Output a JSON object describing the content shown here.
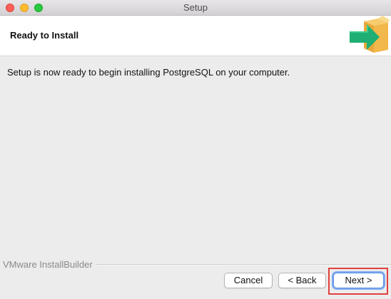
{
  "window": {
    "title": "Setup"
  },
  "header": {
    "title": "Ready to Install",
    "icon": "installer-box-arrow-icon"
  },
  "main": {
    "message": "Setup is now ready to begin installing PostgreSQL on your computer."
  },
  "footer": {
    "brand": "VMware InstallBuilder",
    "cancel_label": "Cancel",
    "back_label": "< Back",
    "next_label": "Next >"
  },
  "colors": {
    "close": "#fe5f57",
    "minimize": "#febc2e",
    "maximize": "#28c840",
    "box": "#f2b84b",
    "arrow": "#1fae73",
    "focus_ring": "#7fa9ef",
    "highlight": "#e0403c"
  }
}
